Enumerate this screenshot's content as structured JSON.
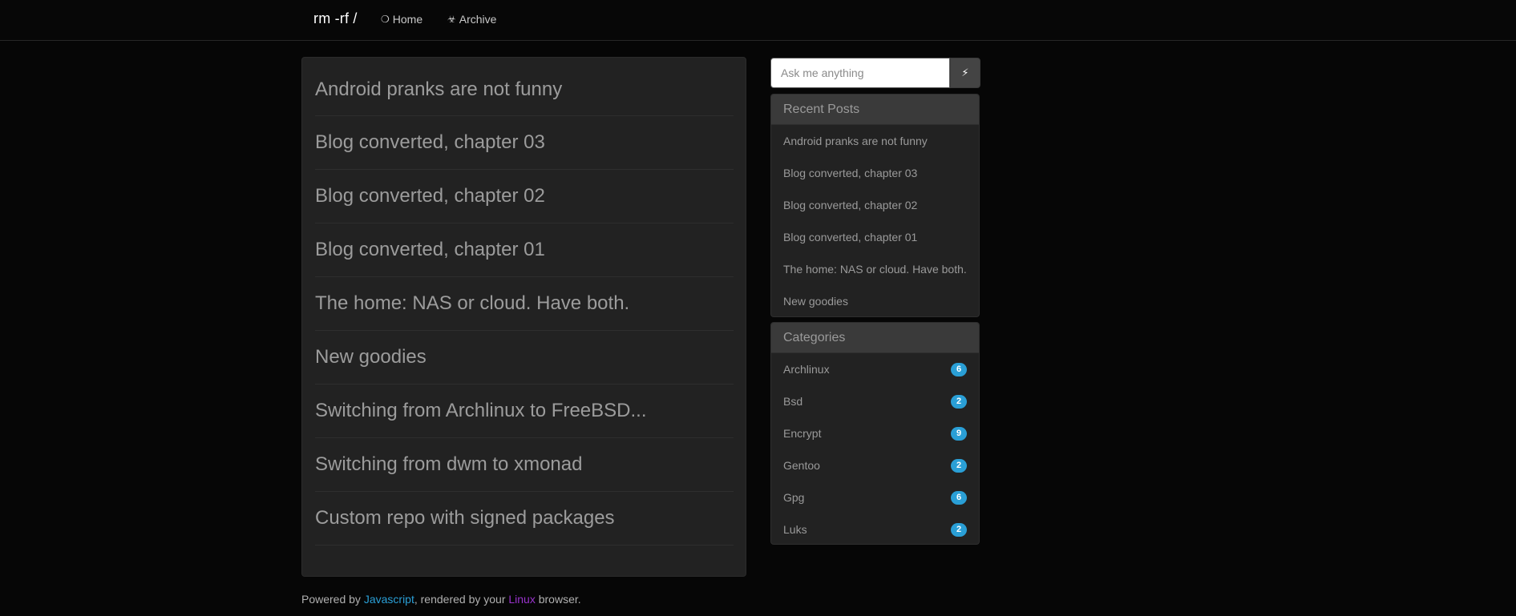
{
  "navbar": {
    "brand": "rm -rf /",
    "links": [
      {
        "icon": "❍",
        "icon_name": "circle-icon",
        "label": "Home"
      },
      {
        "icon": "☣",
        "icon_name": "biohazard-icon",
        "label": "Archive"
      }
    ]
  },
  "posts": [
    "Android pranks are not funny",
    "Blog converted, chapter 03",
    "Blog converted, chapter 02",
    "Blog converted, chapter 01",
    "The home: NAS or cloud. Have both.",
    "New goodies",
    "Switching from Archlinux to FreeBSD...",
    "Switching from dwm to xmonad",
    "Custom repo with signed packages"
  ],
  "search": {
    "placeholder": "Ask me anything",
    "button_icon": "⚡",
    "button_icon_name": "lightning-icon"
  },
  "recent_posts": {
    "heading": "Recent Posts",
    "items": [
      "Android pranks are not funny",
      "Blog converted, chapter 03",
      "Blog converted, chapter 02",
      "Blog converted, chapter 01",
      "The home: NAS or cloud. Have both.",
      "New goodies"
    ]
  },
  "categories": {
    "heading": "Categories",
    "items": [
      {
        "name": "Archlinux",
        "count": "6"
      },
      {
        "name": "Bsd",
        "count": "2"
      },
      {
        "name": "Encrypt",
        "count": "9"
      },
      {
        "name": "Gentoo",
        "count": "2"
      },
      {
        "name": "Gpg",
        "count": "6"
      },
      {
        "name": "Luks",
        "count": "2"
      }
    ]
  },
  "footer": {
    "prefix": "Powered by ",
    "js_link": "Javascript",
    "middle": ", rendered by your ",
    "linux_link": "Linux",
    "suffix": " browser."
  },
  "colors": {
    "accent": "#2a9fd6",
    "linux_link": "#9933cc",
    "background": "#060606",
    "panel": "#222222"
  }
}
